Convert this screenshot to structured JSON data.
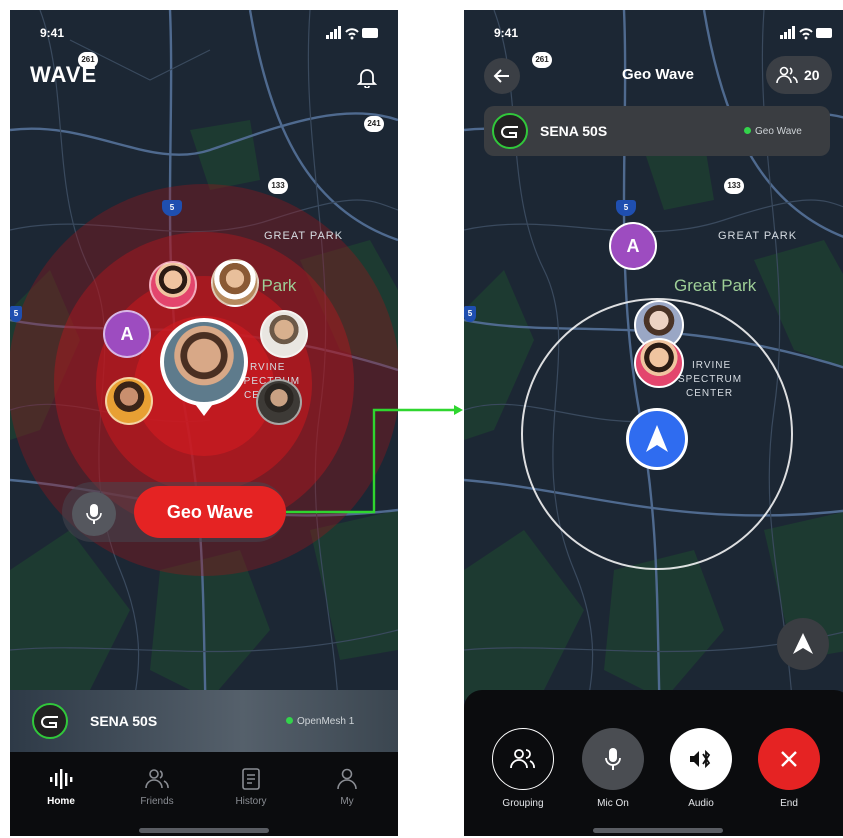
{
  "status": {
    "time": "9:41"
  },
  "left": {
    "logo": "WAVE",
    "map": {
      "route_shields": [
        "261",
        "241",
        "133",
        "5",
        "5"
      ],
      "great_park_label": "GREAT PARK",
      "park_label": "t Park",
      "spectrum_label": [
        "RVINE",
        "SPECTRUM",
        "CENTER"
      ]
    },
    "letter_avatar": "A",
    "geo_wave_button": "Geo Wave",
    "device": {
      "name": "SENA 50S",
      "status": "OpenMesh 1"
    },
    "tabs": [
      {
        "label": "Home",
        "icon": "home-wave-icon",
        "active": true
      },
      {
        "label": "Friends",
        "icon": "friends-icon",
        "active": false
      },
      {
        "label": "History",
        "icon": "history-icon",
        "active": false
      },
      {
        "label": "My",
        "icon": "profile-icon",
        "active": false
      }
    ]
  },
  "right": {
    "title": "Geo Wave",
    "member_count": "20",
    "device": {
      "name": "SENA 50S",
      "status": "Geo Wave"
    },
    "map": {
      "route_shields": [
        "261",
        "133",
        "5",
        "5"
      ],
      "great_park_label": "GREAT PARK",
      "park_label": "Great Park",
      "spectrum_label": [
        "IRVINE",
        "SPECTRUM",
        "CENTER"
      ]
    },
    "letter_avatar": "A",
    "controls": [
      {
        "label": "Grouping",
        "icon": "grouping-icon"
      },
      {
        "label": "Mic On",
        "icon": "mic-icon"
      },
      {
        "label": "Audio",
        "icon": "bluetooth-audio-icon"
      },
      {
        "label": "End",
        "icon": "close-icon"
      }
    ]
  },
  "colors": {
    "accent_red": "#e52323",
    "online_green": "#33d34b",
    "nav_blue": "#2f6cf0",
    "avatar_purple": "#9d4cc0",
    "connector_green": "#2fd62f"
  }
}
